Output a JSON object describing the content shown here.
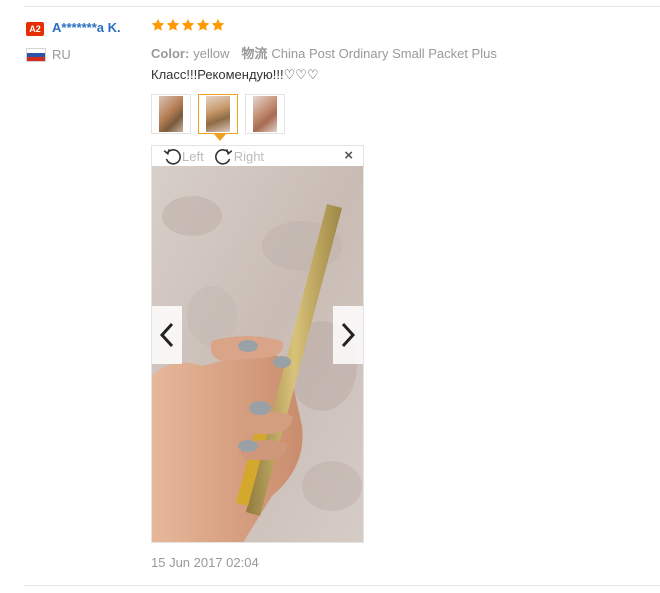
{
  "reviewer": {
    "badge": "A2",
    "name": "A*******a K.",
    "country": "RU"
  },
  "review": {
    "rating": 5,
    "color_key": "Color:",
    "color_value": "yellow",
    "shipping_key": "物流",
    "shipping_value": "China Post Ordinary Small Packet Plus",
    "text": "Класс!!!Рекомендую!!!♡♡♡",
    "date": "15 Jun 2017 02:04"
  },
  "viewer": {
    "rotate_left_label": "Left",
    "rotate_right_label": "Right",
    "close_label": "×",
    "thumbnail_count": 3,
    "selected_thumbnail": 2
  },
  "colors": {
    "star": "#ff9900",
    "username": "#2b6fc2",
    "badge": "#e62e04",
    "selected_border": "#f0a020"
  }
}
